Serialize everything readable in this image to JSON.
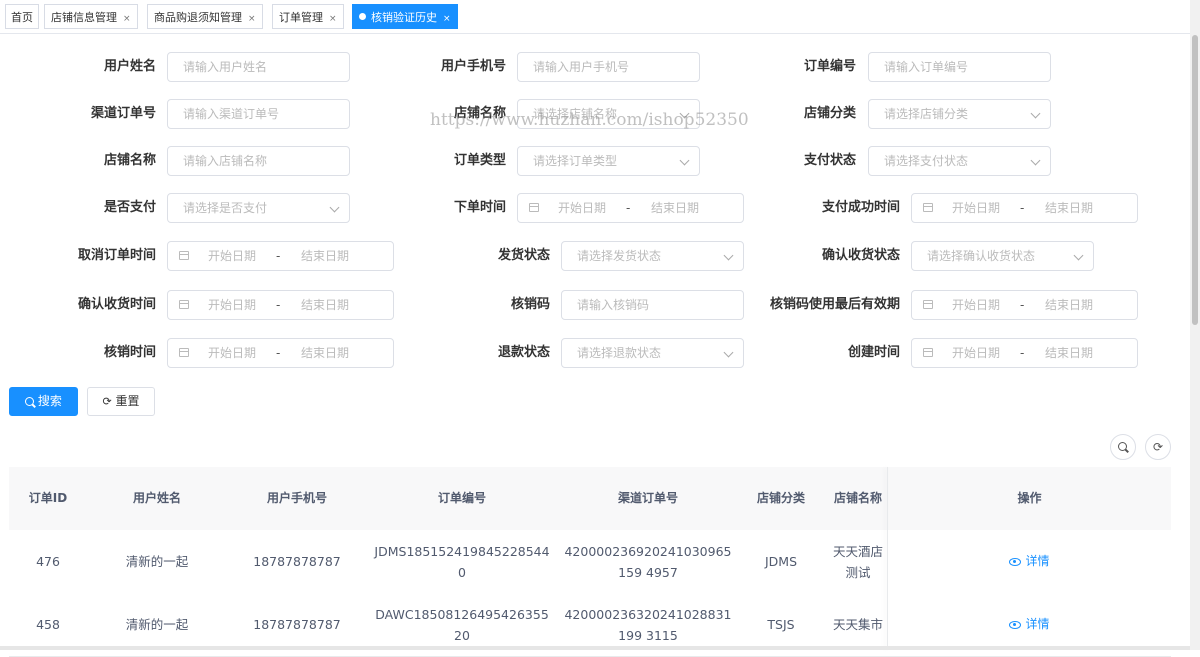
{
  "tabs": [
    {
      "label": "首页",
      "close": false,
      "active": false
    },
    {
      "label": "店铺信息管理",
      "close": true,
      "active": false
    },
    {
      "label": "商品购退须知管理",
      "close": true,
      "active": false
    },
    {
      "label": "订单管理",
      "close": true,
      "active": false
    },
    {
      "label": "核销验证历史",
      "close": true,
      "active": true
    }
  ],
  "close_glyph": "×",
  "form": {
    "user_name": {
      "label": "用户姓名",
      "placeholder": "请输入用户姓名"
    },
    "user_phone": {
      "label": "用户手机号",
      "placeholder": "请输入用户手机号"
    },
    "order_no": {
      "label": "订单编号",
      "placeholder": "请输入订单编号"
    },
    "channel_order_no": {
      "label": "渠道订单号",
      "placeholder": "请输入渠道订单号"
    },
    "store_name_select": {
      "label": "店铺名称",
      "placeholder": "请选择店铺名称"
    },
    "store_category": {
      "label": "店铺分类",
      "placeholder": "请选择店铺分类"
    },
    "store_name": {
      "label": "店铺名称",
      "placeholder": "请输入店铺名称"
    },
    "order_type": {
      "label": "订单类型",
      "placeholder": "请选择订单类型"
    },
    "pay_status": {
      "label": "支付状态",
      "placeholder": "请选择支付状态"
    },
    "is_paid": {
      "label": "是否支付",
      "placeholder": "请选择是否支付"
    },
    "order_time": {
      "label": "下单时间",
      "start": "开始日期",
      "sep": "-",
      "end": "结束日期"
    },
    "pay_success_time": {
      "label": "支付成功时间",
      "start": "开始日期",
      "sep": "-",
      "end": "结束日期"
    },
    "cancel_time": {
      "label": "取消订单时间",
      "start": "开始日期",
      "sep": "-",
      "end": "结束日期"
    },
    "ship_status": {
      "label": "发货状态",
      "placeholder": "请选择发货状态"
    },
    "confirm_status": {
      "label": "确认收货状态",
      "placeholder": "请选择确认收货状态"
    },
    "confirm_time": {
      "label": "确认收货时间",
      "start": "开始日期",
      "sep": "-",
      "end": "结束日期"
    },
    "verify_code": {
      "label": "核销码",
      "placeholder": "请输入核销码"
    },
    "code_expiry": {
      "label": "核销码使用最后有效期",
      "start": "开始日期",
      "sep": "-",
      "end": "结束日期"
    },
    "verify_time": {
      "label": "核销时间",
      "start": "开始日期",
      "sep": "-",
      "end": "结束日期"
    },
    "refund_status": {
      "label": "退款状态",
      "placeholder": "请选择退款状态"
    },
    "create_time": {
      "label": "创建时间",
      "start": "开始日期",
      "sep": "-",
      "end": "结束日期"
    }
  },
  "buttons": {
    "search": "搜索",
    "reset": "重置"
  },
  "watermark": "https://www.huzhan.com/ishop52350",
  "table": {
    "columns": [
      "订单ID",
      "用户姓名",
      "用户手机号",
      "订单编号",
      "渠道订单号",
      "店铺分类",
      "店铺名称",
      "操作"
    ],
    "rows": [
      {
        "id": "476",
        "name": "清新的一起",
        "phone": "18787878787",
        "order_no": "JDMS1851524198452285440",
        "channel_no": "420000236920241030965159 4957",
        "category": "JDMS",
        "store": "天天酒店测试",
        "action": "详情"
      },
      {
        "id": "458",
        "name": "清新的一起",
        "phone": "18787878787",
        "order_no": "DAWC1850812649542635520",
        "channel_no": "420000236320241028831199 3115",
        "category": "TSJS",
        "store": "天天集市",
        "action": "详情"
      }
    ]
  },
  "colors": {
    "primary": "#1890ff",
    "border": "#dcdfe6",
    "header_bg": "#f8f8f9"
  },
  "icons": {
    "search": "search-icon",
    "refresh": "refresh-icon",
    "calendar": "calendar-icon",
    "eye": "eye-icon",
    "arrow": "chevron-down-icon"
  }
}
